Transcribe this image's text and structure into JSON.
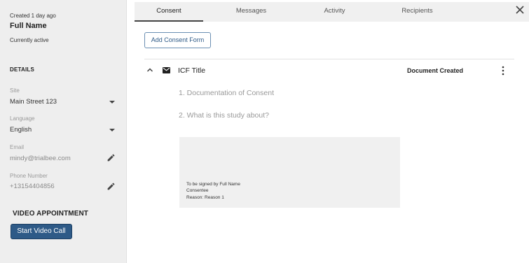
{
  "patient": {
    "created": "Created 1 day ago",
    "name": "Full Name",
    "status": "Currently active"
  },
  "details": {
    "title": "DETAILS",
    "site_label": "Site",
    "site_value": "Main Street 123",
    "language_label": "Language",
    "language_value": "English",
    "email_label": "Email",
    "email_value": "mindy@trialbee.com",
    "phone_label": "Phone Number",
    "phone_value": "+13154404856"
  },
  "video": {
    "title": "VIDEO APPOINTMENT",
    "button_label": "Start Video Call"
  },
  "tabs": [
    {
      "label": "Consent",
      "active": true
    },
    {
      "label": "Messages",
      "active": false
    },
    {
      "label": "Activity",
      "active": false
    },
    {
      "label": "Recipients",
      "active": false
    }
  ],
  "consent": {
    "add_button_label": "Add Consent Form",
    "form_title": "ICF Title",
    "form_status": "Document Created",
    "sections": [
      "1. Documentation of Consent",
      "2. What is this study about?"
    ],
    "signature": {
      "line1": "To be signed by Full Name",
      "line2": "Consentee",
      "line3": "Reason: Reason 1"
    }
  },
  "icons": {
    "caret": "chevron-down-icon",
    "edit": "pencil-icon",
    "close": "close-icon",
    "collapse": "chevron-up-icon",
    "mail": "envelope-icon",
    "more": "more-vertical-icon"
  },
  "colors": {
    "primary": "#2e5a87",
    "sidebar_bg": "#eeeeee",
    "tabbar_bg": "#f0f0f0"
  }
}
